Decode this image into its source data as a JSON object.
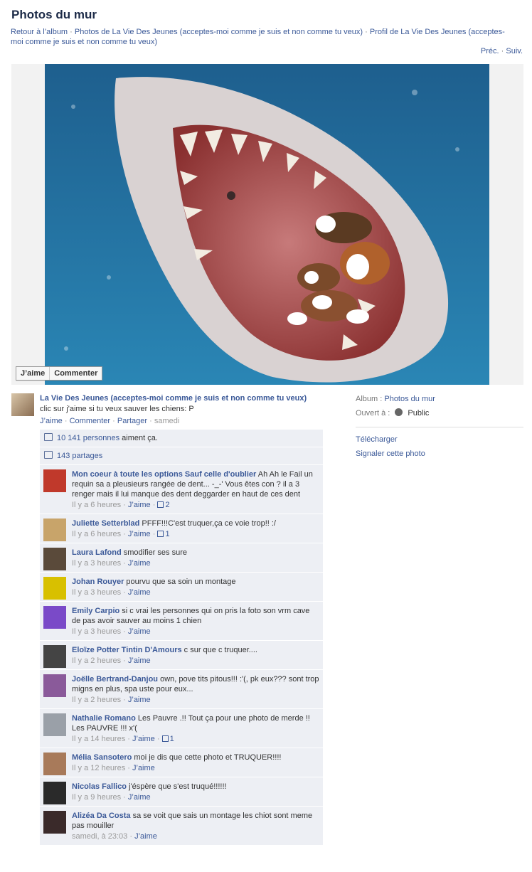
{
  "page": {
    "title": "Photos du mur",
    "breadcrumb": {
      "back": "Retour à l’album",
      "photos_of": "Photos de La Vie Des Jeunes (acceptes-moi comme je suis et non comme tu veux)",
      "profile": "Profil de La Vie Des Jeunes (acceptes-moi comme je suis et non comme tu veux)"
    },
    "pager": {
      "prev": "Préc.",
      "next": "Suiv."
    }
  },
  "photo_actions": {
    "like": "J’aime",
    "comment": "Commenter"
  },
  "post": {
    "author": "La Vie Des Jeunes (acceptes-moi comme je suis et non comme tu veux)",
    "caption": "clic sur j'aime si tu veux sauver les chiens: P",
    "like": "J’aime",
    "comment": "Commenter",
    "share": "Partager",
    "time": "samedi"
  },
  "sidebar": {
    "album_label": "Album :",
    "album_value": "Photos du mur",
    "open_label": "Ouvert à :",
    "open_value": "Public",
    "download": "Télécharger",
    "report": "Signaler cette photo"
  },
  "stats": {
    "likes_link": "10 141 personnes",
    "likes_text": " aiment ça.",
    "shares": "143 partages"
  },
  "comments": [
    {
      "author": "Mon coeur à toute les options Sauf celle d'oublier",
      "text": " Ah Ah le Fail un requin sa a pleusieurs rangée de dent... -_-' Vous êtes con ? il a 3 renger mais il lui manque des dent deggarder en haut de ces dent",
      "time": "Il y a 6 heures",
      "like": "J’aime",
      "likes": "2",
      "avatar_color": "#c0392b"
    },
    {
      "author": "Juliette Setterblad",
      "text": " PFFF!!!C'est truquer,ça ce voie trop!! :/",
      "time": "Il y a 6 heures",
      "like": "J’aime",
      "likes": "1",
      "avatar_color": "#c8a46a"
    },
    {
      "author": "Laura Lafond",
      "text": " smodifier ses sure",
      "time": "Il y a 3 heures",
      "like": "J’aime",
      "likes": "",
      "avatar_color": "#5a4a3a"
    },
    {
      "author": "Johan Rouyer",
      "text": " pourvu que sa soin un montage",
      "time": "Il y a 3 heures",
      "like": "J’aime",
      "likes": "",
      "avatar_color": "#d8c000"
    },
    {
      "author": "Emily Carpio",
      "text": " si c vrai les personnes qui on pris la foto son vrm cave de pas avoir sauver au moins 1 chien",
      "time": "Il y a 3 heures",
      "like": "J’aime",
      "likes": "",
      "avatar_color": "#7a4ac8"
    },
    {
      "author": "Eloïze Potter Tintin D'Amours",
      "text": " c sur que c truquer....",
      "time": "Il y a 2 heures",
      "like": "J’aime",
      "likes": "",
      "avatar_color": "#444444"
    },
    {
      "author": "Joëlle Bertrand-Danjou",
      "text": " own, pove tits pitous!!! :'(, pk eux??? sont trop migns en plus, spa uste pour eux...",
      "time": "Il y a 2 heures",
      "like": "J’aime",
      "likes": "",
      "avatar_color": "#8a5a9a"
    },
    {
      "author": "Nathalie Romano",
      "text": " Les Pauvre .!! Tout ça pour une photo de merde !! Les PAUVRE !!! x'(",
      "time": "Il y a 14 heures",
      "like": "J’aime",
      "likes": "1",
      "avatar_color": "#9aa0a8"
    },
    {
      "author": "Mélia Sansotero",
      "text": " moi je dis que cette photo et TRUQUER!!!!",
      "time": "Il y a 12 heures",
      "like": "J’aime",
      "likes": "",
      "avatar_color": "#a87a5a"
    },
    {
      "author": "Nicolas Fallico",
      "text": " j'éspère que s'est truqué!!!!!!",
      "time": "Il y a 9 heures",
      "like": "J’aime",
      "likes": "",
      "avatar_color": "#2a2a2a"
    },
    {
      "author": "Alizéa Da Costa",
      "text": " sa se voit que sais un montage les chiot sont meme pas mouiller",
      "time": "samedi, à 23:03",
      "like": "J’aime",
      "likes": "",
      "avatar_color": "#3a2a2a"
    }
  ]
}
